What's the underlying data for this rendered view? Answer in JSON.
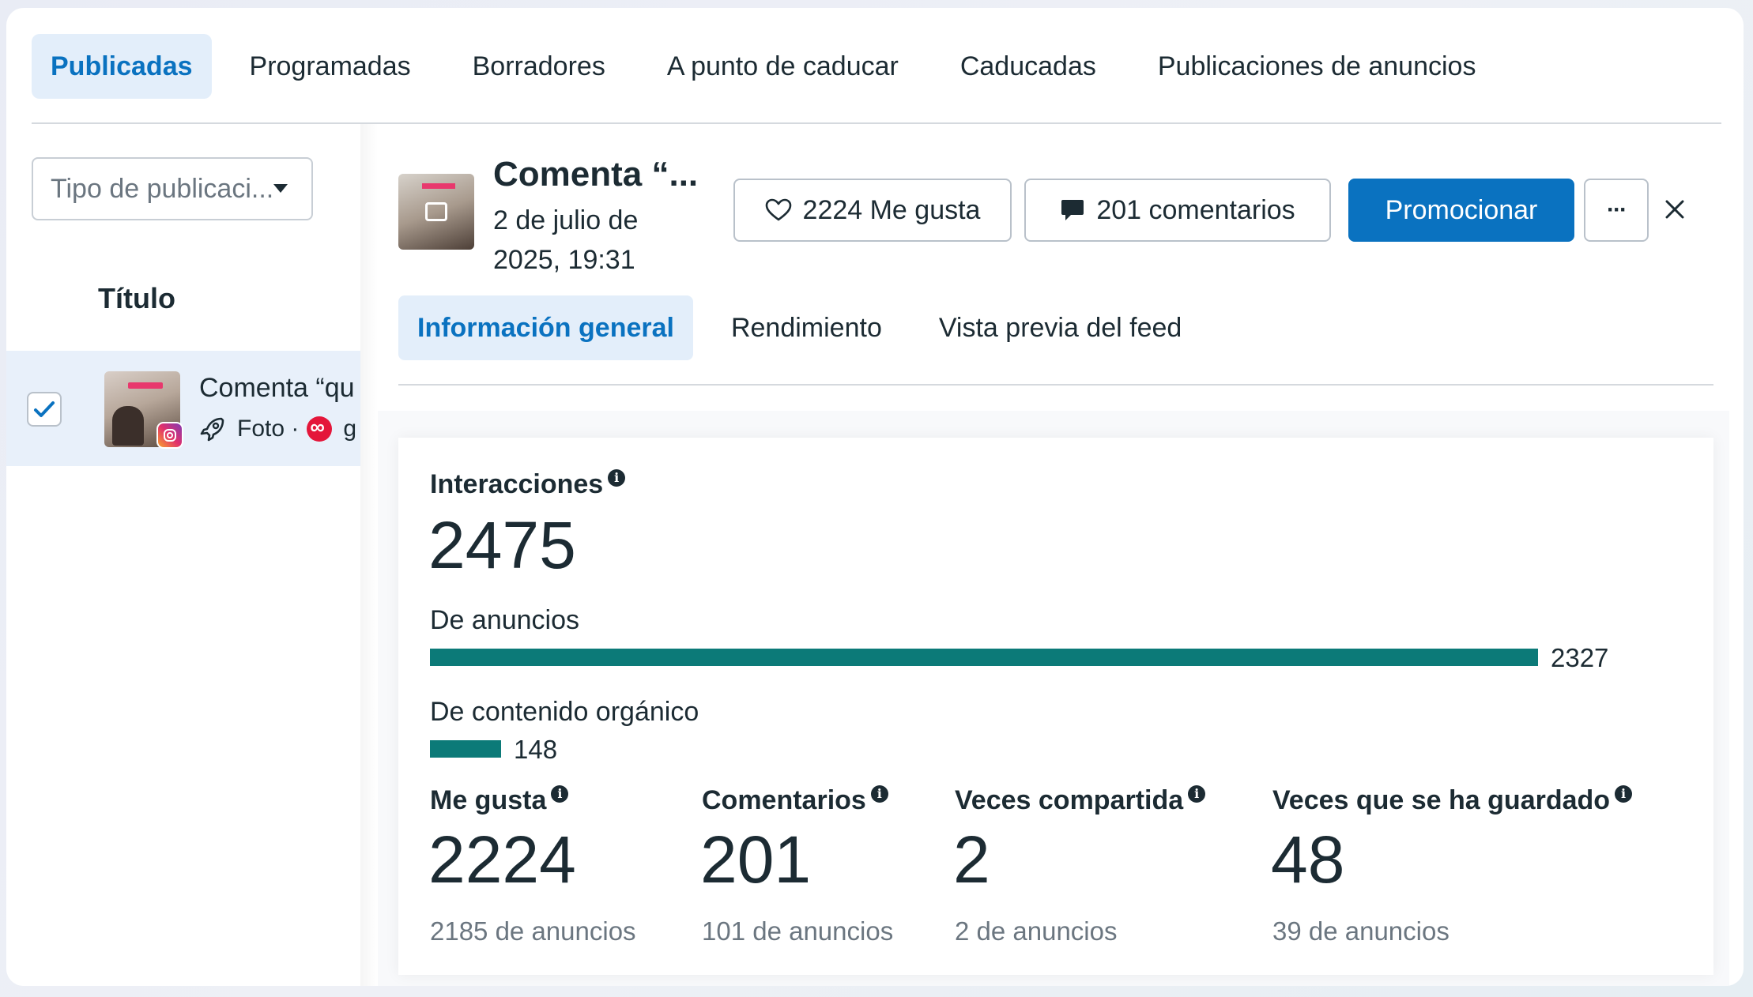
{
  "top_tabs": [
    {
      "label": "Publicadas",
      "active": true
    },
    {
      "label": "Programadas",
      "active": false
    },
    {
      "label": "Borradores",
      "active": false
    },
    {
      "label": "A punto de caducar",
      "active": false
    },
    {
      "label": "Caducadas",
      "active": false
    },
    {
      "label": "Publicaciones de anuncios",
      "active": false
    }
  ],
  "filter": {
    "type_placeholder": "Tipo de publicaci..."
  },
  "list": {
    "column_title": "Título",
    "row": {
      "title": "Comenta “qu",
      "meta_type": "Foto ·",
      "meta_extra": "g"
    }
  },
  "detail": {
    "title": "Comenta “...",
    "date": "2 de julio de 2025, 19:31",
    "likes_button": "2224 Me gusta",
    "comments_button": "201 comentarios",
    "promote_button": "Promocionar",
    "more_button": "···",
    "tabs": [
      {
        "label": "Información general",
        "active": true
      },
      {
        "label": "Rendimiento",
        "active": false
      },
      {
        "label": "Vista previa del feed",
        "active": false
      }
    ]
  },
  "overview": {
    "interactions_label": "Interacciones",
    "interactions_value": "2475",
    "from_ads_label": "De anuncios",
    "from_ads_value": "2327",
    "from_ads_fraction": 0.94,
    "organic_label": "De contenido orgánico",
    "organic_value": "148",
    "organic_fraction": 0.06,
    "metrics": [
      {
        "label": "Me gusta",
        "value": "2224",
        "sub": "2185 de anuncios"
      },
      {
        "label": "Comentarios",
        "value": "201",
        "sub": "101 de anuncios"
      },
      {
        "label": "Veces compartida",
        "value": "2",
        "sub": "2 de anuncios"
      },
      {
        "label": "Veces que se ha guardado",
        "value": "48",
        "sub": "39 de anuncios"
      }
    ]
  },
  "colors": {
    "accent": "#0a72c0",
    "bar": "#0c7a78",
    "tab_active_bg": "#e3eefa",
    "row_selected_bg": "#e8f0fa"
  },
  "icons": [
    "caret-down-icon",
    "checkmark-icon",
    "instagram-icon",
    "rocket-icon",
    "ads-icon",
    "heart-icon",
    "comment-icon",
    "more-icon",
    "close-icon",
    "info-icon",
    "image-icon"
  ]
}
